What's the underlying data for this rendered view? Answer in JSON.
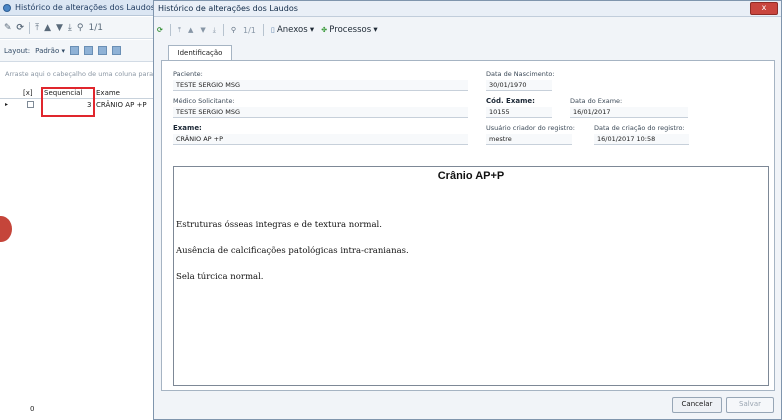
{
  "background_window": {
    "title": "Histórico de alterações dos Laudos",
    "toolbar_page": "1/1",
    "layout_label": "Layout:",
    "layout_value": "Padrão",
    "group_hint": "Arraste aqui o cabeçalho de uma coluna para",
    "columns": [
      "[x]",
      "Sequencial",
      "Exame"
    ],
    "row": {
      "sequencial": "3",
      "exame": "CRÂNIO AP +P"
    },
    "footer_count": "0"
  },
  "dialog": {
    "title": "Histórico de alterações dos Laudos",
    "close_label": "x",
    "toolbar": {
      "page": "1/1",
      "anexos": "Anexos",
      "processos": "Processos"
    },
    "tab": "Identificação",
    "fields": {
      "paciente_label": "Paciente:",
      "paciente_value": "TESTE SERGIO MSG",
      "nascimento_label": "Data de Nascimento:",
      "nascimento_value": "30/01/1970",
      "medico_label": "Médico Solicitante:",
      "medico_value": "TESTE SERGIO MSG",
      "cod_exame_label": "Cód. Exame:",
      "cod_exame_value": "10155",
      "data_exame_label": "Data do Exame:",
      "data_exame_value": "16/01/2017",
      "exame_label": "Exame:",
      "exame_value": "CRÂNIO AP +P",
      "usuario_label": "Usuário criador do registro:",
      "usuario_value": "mestre",
      "data_criacao_label": "Data de criação do registro:",
      "data_criacao_value": "16/01/2017 10:58"
    },
    "report": {
      "title": "Crânio AP+P",
      "lines": [
        "Estruturas ósseas integras e de textura normal.",
        "Ausência de calcificações patológicas intra-cranianas.",
        "Sela túrcica normal."
      ]
    },
    "buttons": {
      "cancel": "Cancelar",
      "save": "Salvar"
    }
  }
}
